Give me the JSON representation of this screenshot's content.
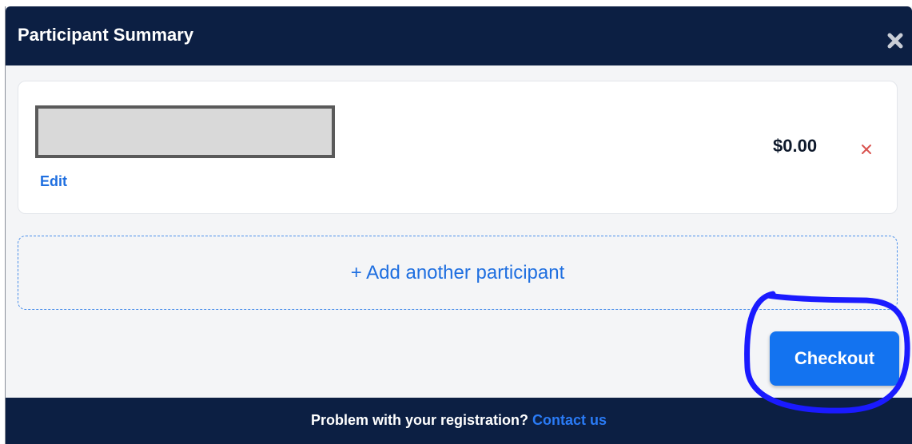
{
  "modal": {
    "title": "Participant Summary"
  },
  "participant": {
    "edit_label": "Edit",
    "price": "$0.00"
  },
  "add_participant": {
    "label": "+ Add another participant"
  },
  "checkout": {
    "label": "Checkout"
  },
  "footer": {
    "question": "Problem with your registration?",
    "link_label": "Contact us"
  },
  "icons": {
    "close": "close-icon",
    "remove": "remove-icon"
  },
  "colors": {
    "header_bg": "#0c1f43",
    "accent": "#1373f0",
    "remove": "#d9534f",
    "annotation": "#1a1aff"
  }
}
